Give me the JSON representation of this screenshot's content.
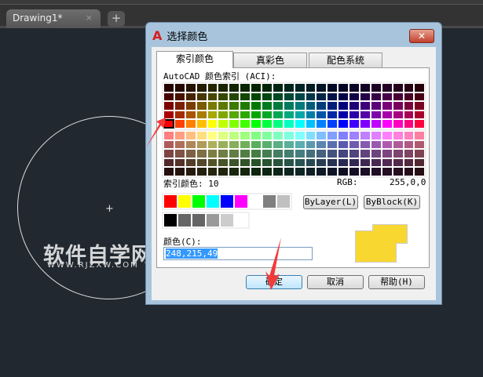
{
  "app": {
    "doc_tab": "Drawing1*",
    "close_tab": "×",
    "new_tab": "+"
  },
  "watermark": {
    "title": "软件自学网",
    "url": "WWW.RJZXW.COM"
  },
  "dialog": {
    "title": "选择颜色",
    "close": "✕",
    "tabs": [
      {
        "label": "索引颜色"
      },
      {
        "label": "真彩色"
      },
      {
        "label": "配色系统"
      }
    ],
    "aci_label": "AutoCAD 颜色索引 (ACI):",
    "index_label": "索引颜色: 10",
    "rgb_label": "RGB:",
    "rgb_value": "255,0,0",
    "bylayer": "ByLayer(L)",
    "byblock": "ByBlock(K)",
    "color_label": "颜色(C):",
    "color_value": "248,215,49",
    "ok": "确定",
    "cancel": "取消",
    "help": "帮助(H)",
    "selected_color": "#f8d731",
    "standard_colors": [
      "#ff0000",
      "#ffff00",
      "#00ff00",
      "#00ffff",
      "#0000ff",
      "#ff00ff",
      "#ffffff",
      "#808080",
      "#c0c0c0"
    ],
    "gray_colors": [
      "#000000",
      "#656565",
      "#656565",
      "#999999",
      "#cccccc",
      "#ffffff"
    ]
  }
}
